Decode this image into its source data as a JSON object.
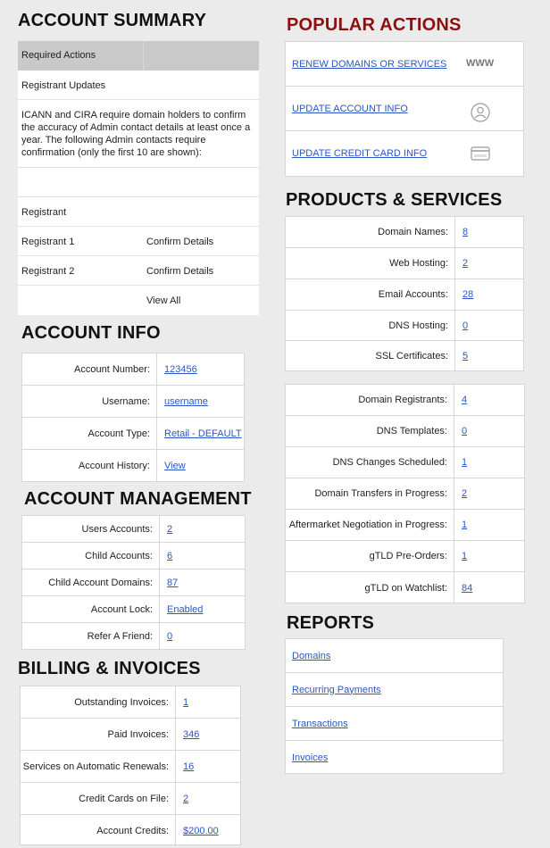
{
  "account_summary": {
    "title": "ACCOUNT SUMMARY",
    "required_actions": "Required Actions",
    "registrant_updates": "Registrant Updates",
    "notice": "ICANN and CIRA require domain holders to confirm the accuracy of Admin contact details at least once a year. The following Admin contacts require confirmation (only the first 10 are shown):",
    "registrant_header": "Registrant",
    "registrants": [
      {
        "name": "Registrant 1",
        "action": "Confirm Details"
      },
      {
        "name": "Registrant 2",
        "action": "Confirm Details"
      }
    ],
    "view_all": "View All"
  },
  "account_info": {
    "title": "ACCOUNT INFO",
    "rows": [
      {
        "label": "Account Number:",
        "value": "123456"
      },
      {
        "label": "Username:",
        "value": "username"
      },
      {
        "label": "Account Type:",
        "value": "Retail - DEFAULT"
      },
      {
        "label": "Account History:",
        "value": "View"
      }
    ]
  },
  "account_management": {
    "title": "ACCOUNT MANAGEMENT",
    "rows": [
      {
        "label": "Users Accounts:",
        "value": "2"
      },
      {
        "label": "Child Accounts:",
        "value": "6"
      },
      {
        "label": "Child Account Domains:",
        "value": "87"
      },
      {
        "label": "Account Lock:",
        "value": "Enabled"
      },
      {
        "label": "Refer A Friend:",
        "value": "0"
      }
    ]
  },
  "billing": {
    "title": "BILLING & INVOICES",
    "rows": [
      {
        "label": "Outstanding Invoices:",
        "value": "1"
      },
      {
        "label": "Paid Invoices:",
        "value": "346"
      },
      {
        "label": "Services on Automatic Renewals:",
        "value": "16"
      },
      {
        "label": "Credit Cards on File:",
        "value": "2"
      },
      {
        "label": "Account Credits:",
        "value": "$200.00"
      }
    ]
  },
  "popular_actions": {
    "title": "POPULAR ACTIONS",
    "items": [
      {
        "label": "RENEW DOMAINS OR SERVICES",
        "icon": "www-icon",
        "icon_text": "WWW"
      },
      {
        "label": "UPDATE ACCOUNT INFO",
        "icon": "user-icon"
      },
      {
        "label": "UPDATE CREDIT CARD INFO",
        "icon": "credit-card-icon"
      }
    ]
  },
  "products": {
    "title": "PRODUCTS & SERVICES",
    "rows": [
      {
        "label": "Domain Names:",
        "value": "8"
      },
      {
        "label": "Web Hosting:",
        "value": "2"
      },
      {
        "label": "Email Accounts:",
        "value": "28"
      },
      {
        "label": "DNS Hosting:",
        "value": "0"
      },
      {
        "label": "SSL Certificates:",
        "value": "5"
      }
    ]
  },
  "domains_stats": {
    "rows": [
      {
        "label": "Domain Registrants:",
        "value": "4"
      },
      {
        "label": "DNS Templates:",
        "value": "0"
      },
      {
        "label": "DNS Changes Scheduled:",
        "value": "1"
      },
      {
        "label": "Domain Transfers in Progress:",
        "value": "2"
      },
      {
        "label": "Aftermarket Negotiation in Progress:",
        "value": "1"
      },
      {
        "label": "gTLD Pre-Orders:",
        "value": "1"
      },
      {
        "label": "gTLD on Watchlist:",
        "value": "84"
      }
    ]
  },
  "reports": {
    "title": "REPORTS",
    "items": [
      "Domains",
      "Recurring Payments",
      "Transactions",
      "Invoices"
    ]
  },
  "colors": {
    "accent_red": "#8b1111",
    "link": "#2a56c6",
    "background": "#ebebeb"
  }
}
